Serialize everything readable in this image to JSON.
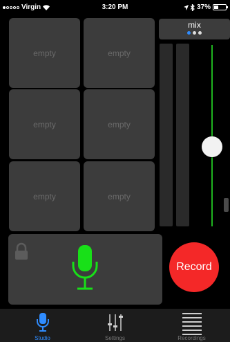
{
  "status_bar": {
    "signal_strength": 1,
    "carrier": "Virgin",
    "time": "3:20 PM",
    "battery_percent": "37%",
    "battery_level": 0.37
  },
  "pads": [
    {
      "label": "empty"
    },
    {
      "label": "empty"
    },
    {
      "label": "empty"
    },
    {
      "label": "empty"
    },
    {
      "label": "empty"
    },
    {
      "label": "empty"
    }
  ],
  "mix": {
    "label": "mix",
    "page_count": 3,
    "active_page": 0,
    "fader_level": 0.44,
    "fader_color": "#1fb41f"
  },
  "mic_panel": {
    "lock_icon": "lock-icon",
    "mic_icon": "microphone-icon",
    "mic_color": "#18e018"
  },
  "record_button": {
    "label": "Record",
    "color": "#f42828"
  },
  "tab_bar": {
    "active_color": "#2f8cff",
    "tabs": [
      {
        "label": "Studio",
        "icon": "microphone-icon",
        "active": true
      },
      {
        "label": "Settings",
        "icon": "sliders-icon",
        "active": false
      },
      {
        "label": "Recordings",
        "icon": "list-icon",
        "active": false
      }
    ]
  }
}
